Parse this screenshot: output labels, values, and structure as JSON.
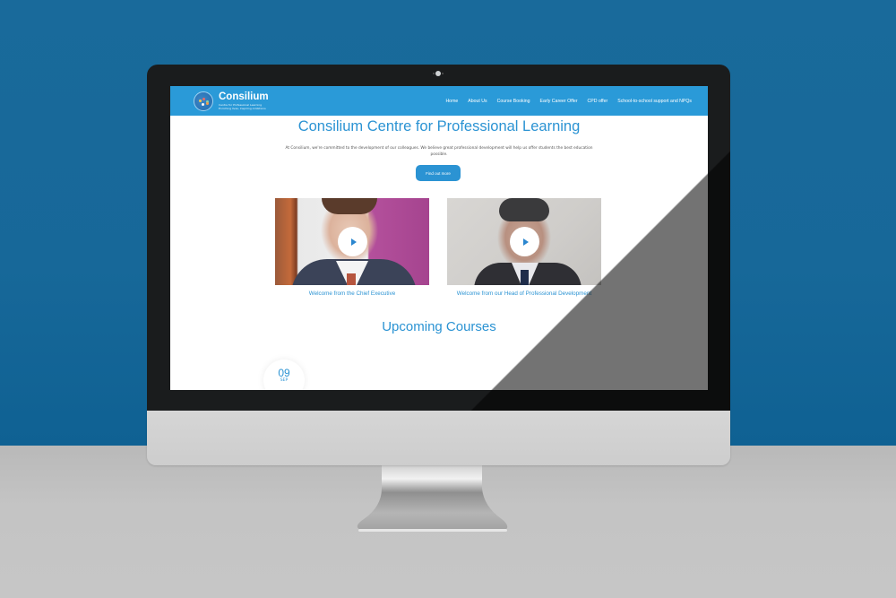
{
  "site": {
    "logo": {
      "name": "Consilium",
      "tagline_line1": "Centre for Professional Learning",
      "tagline_line2": "Enriching lives, Inspiring Ambitions"
    },
    "nav": {
      "items": [
        {
          "label": "Home"
        },
        {
          "label": "About Us"
        },
        {
          "label": "Course Booking"
        },
        {
          "label": "Early Career Offer"
        },
        {
          "label": "CPD offer"
        },
        {
          "label": "School-to-school support and NPQs"
        }
      ]
    },
    "hero": {
      "title": "Consilium Centre for Professional Learning",
      "text": "At Consilium, we're committed to the development of our colleagues. We believe great professional development will help us offer students the best education possible.",
      "button_label": "Find out more"
    },
    "videos": [
      {
        "caption": "Welcome from the Chief Executive",
        "icon": "play-icon"
      },
      {
        "caption": "Welcome from our Head of Professional Development",
        "icon": "play-icon"
      }
    ],
    "upcoming": {
      "title": "Upcoming Courses",
      "first_date": {
        "day": "09",
        "month": "SEP"
      }
    }
  },
  "colors": {
    "brand_blue": "#2b93d3",
    "navbar_blue": "#2a9ad8",
    "backdrop_blue": "#196a9b",
    "desk_grey": "#c3c3c3",
    "bezel": "#1a1c1d"
  }
}
